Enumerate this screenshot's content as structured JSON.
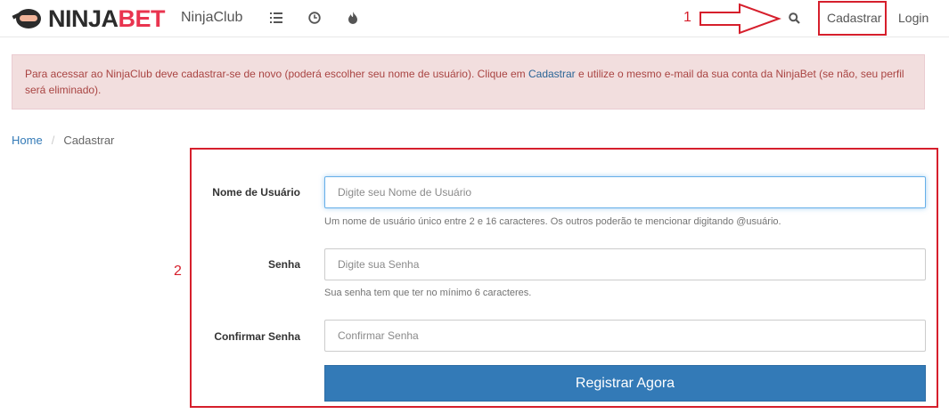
{
  "navbar": {
    "logo_part1": "NINJA",
    "logo_part2": "BET",
    "brand": "NinjaClub",
    "icons": [
      "list-icon",
      "clock-icon",
      "fire-icon",
      "search-icon"
    ],
    "register_label": "Cadastrar",
    "login_label": "Login"
  },
  "annotations": {
    "one": "1",
    "two": "2"
  },
  "alert": {
    "text_before": "Para acessar ao NinjaClub deve cadastrar-se de novo (poderá escolher seu nome de usuário). Clique em ",
    "link": "Cadastrar",
    "text_after": " e utilize o mesmo e-mail da sua conta da NinjaBet (se não, seu perfil será eliminado)."
  },
  "breadcrumb": {
    "home": "Home",
    "separator": "/",
    "current": "Cadastrar"
  },
  "form": {
    "username": {
      "label": "Nome de Usuário",
      "placeholder": "Digite seu Nome de Usuário",
      "help": "Um nome de usuário único entre 2 e 16 caracteres. Os outros poderão te mencionar digitando @usuário."
    },
    "password": {
      "label": "Senha",
      "placeholder": "Digite sua Senha",
      "help": "Sua senha tem que ter no mínimo 6 caracteres."
    },
    "confirm": {
      "label": "Confirmar Senha",
      "placeholder": "Confirmar Senha"
    },
    "submit_label": "Registrar Agora"
  },
  "colors": {
    "annotation_red": "#d61f2c",
    "primary_button": "#337ab7",
    "alert_bg": "#f2dede",
    "alert_text": "#a94442",
    "logo_red": "#e9344f"
  }
}
